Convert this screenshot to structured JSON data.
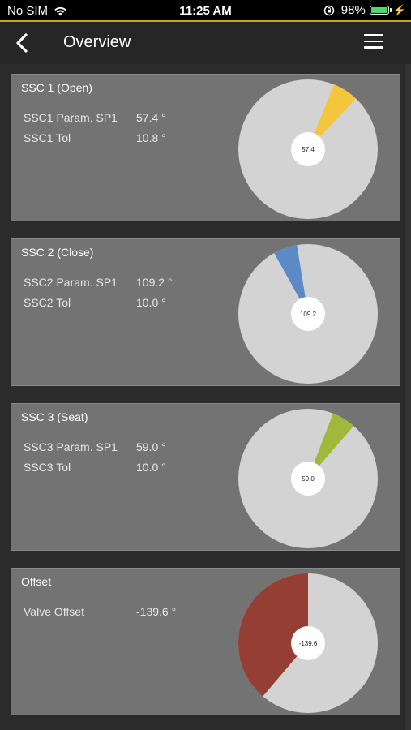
{
  "status_bar": {
    "carrier": "No SIM",
    "time": "11:25 AM",
    "battery": "98%"
  },
  "nav": {
    "title": "Overview"
  },
  "cards": [
    {
      "title": "SSC 1 (Open)",
      "params": [
        {
          "label": "SSC1 Param. SP1",
          "value": "57.4 °"
        },
        {
          "label": "SSC1 Tol",
          "value": "10.8 °"
        }
      ],
      "gauge": {
        "center_label": "57.4",
        "angle_deg": 57.4,
        "tolerance_deg": 10.8,
        "color": "#f3c63e"
      }
    },
    {
      "title": "SSC 2 (Close)",
      "params": [
        {
          "label": "SSC2 Param. SP1",
          "value": "109.2 °"
        },
        {
          "label": "SSC2 Tol",
          "value": "10.0 °"
        }
      ],
      "gauge": {
        "center_label": "109.2",
        "angle_deg": 109.2,
        "tolerance_deg": 10.0,
        "color": "#5b8ac6"
      }
    },
    {
      "title": "SSC 3 (Seat)",
      "params": [
        {
          "label": "SSC3 Param. SP1",
          "value": "59.0 °"
        },
        {
          "label": "SSC3 Tol",
          "value": "10.0 °"
        }
      ],
      "gauge": {
        "center_label": "59.0",
        "angle_deg": 59.0,
        "tolerance_deg": 10.0,
        "color": "#a2b83b"
      }
    },
    {
      "title": "Offset",
      "params": [
        {
          "label": "Valve Offset",
          "value": "-139.6 °"
        }
      ],
      "gauge": {
        "center_label": "-139.6",
        "angle_deg": -139.6,
        "tolerance_deg": 0,
        "color": "#953e34"
      }
    }
  ],
  "colors": {
    "pie_background": "#d3d3d3",
    "card_background": "#737373",
    "accent": "#c9a227"
  }
}
